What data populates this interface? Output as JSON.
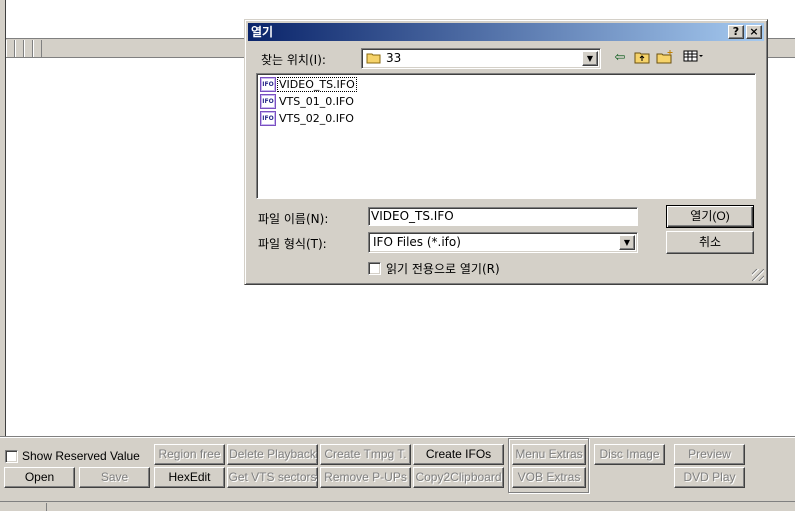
{
  "app": {
    "checkbox_label": "Show Reserved Value",
    "row1_buttons": [
      "Region free",
      "Delete Playback",
      "Create Tmpg T.",
      "Create IFOs",
      "Menu Extras",
      "Disc Image",
      "Preview"
    ],
    "row2_buttons": [
      "Open",
      "Save",
      "HexEdit",
      "Get VTS sectors",
      "Remove P-UPs",
      "Copy2Clipboard",
      "VOB Extras",
      "DVD Play"
    ]
  },
  "dialog": {
    "title": "열기",
    "help_btn": "?",
    "close_btn": "×",
    "look_in_label": "찾는 위치(I):",
    "look_in_value": "33",
    "files": [
      "VIDEO_TS.IFO",
      "VTS_01_0.IFO",
      "VTS_02_0.IFO"
    ],
    "file_icon_text": "IFO",
    "filename_label": "파일 이름(N):",
    "filename_value": "VIDEO_TS.IFO",
    "filetype_label": "파일 형식(T):",
    "filetype_value": "IFO Files (*.ifo)",
    "readonly_label": "읽기 전용으로 열기(R)",
    "open_btn": "열기(O)",
    "cancel_btn": "취소",
    "icons": [
      "folder-icon",
      "back-arrow-icon",
      "up-folder-icon",
      "new-folder-icon",
      "view-menu-icon"
    ]
  }
}
